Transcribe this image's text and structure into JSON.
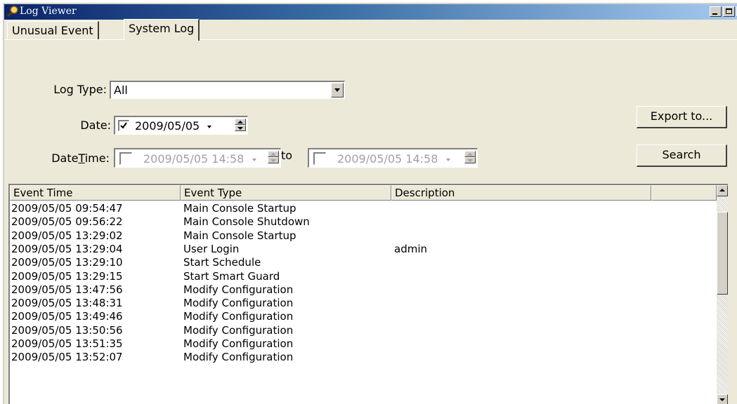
{
  "window": {
    "title": "Log Viewer",
    "icon": "search-magnifier-icon"
  },
  "tabs": [
    {
      "label": "Unusual Event",
      "selected": false
    },
    {
      "label": "System Log",
      "selected": true
    }
  ],
  "form": {
    "log_type_label": "Log Type:",
    "log_type_value": "All",
    "date_label": "Date:",
    "date_checked": true,
    "date_value": "2009/05/05",
    "datetime_label_pre": "Date",
    "datetime_label_ul": "T",
    "datetime_label_post": "ime:",
    "datetime_from_value": "2009/05/05 14:58",
    "datetime_to_label": "to",
    "datetime_to_value": "2009/05/05 14:58",
    "export_button": "Export to...",
    "search_button": "Search"
  },
  "list": {
    "columns": [
      "Event Time",
      "Event Type",
      "Description",
      ""
    ],
    "rows": [
      [
        "2009/05/05 09:54:47",
        "Main Console Startup",
        ""
      ],
      [
        "2009/05/05 09:56:22",
        "Main Console Shutdown",
        ""
      ],
      [
        "2009/05/05 13:29:02",
        "Main Console Startup",
        ""
      ],
      [
        "2009/05/05 13:29:04",
        "User Login",
        "admin"
      ],
      [
        "2009/05/05 13:29:10",
        "Start Schedule",
        ""
      ],
      [
        "2009/05/05 13:29:15",
        "Start Smart Guard",
        ""
      ],
      [
        "2009/05/05 13:47:56",
        "Modify Configuration",
        ""
      ],
      [
        "2009/05/05 13:48:31",
        "Modify Configuration",
        ""
      ],
      [
        "2009/05/05 13:49:46",
        "Modify Configuration",
        ""
      ],
      [
        "2009/05/05 13:50:56",
        "Modify Configuration",
        ""
      ],
      [
        "2009/05/05 13:51:35",
        "Modify Configuration",
        ""
      ],
      [
        "2009/05/05 13:52:07",
        "Modify Configuration",
        ""
      ]
    ]
  }
}
